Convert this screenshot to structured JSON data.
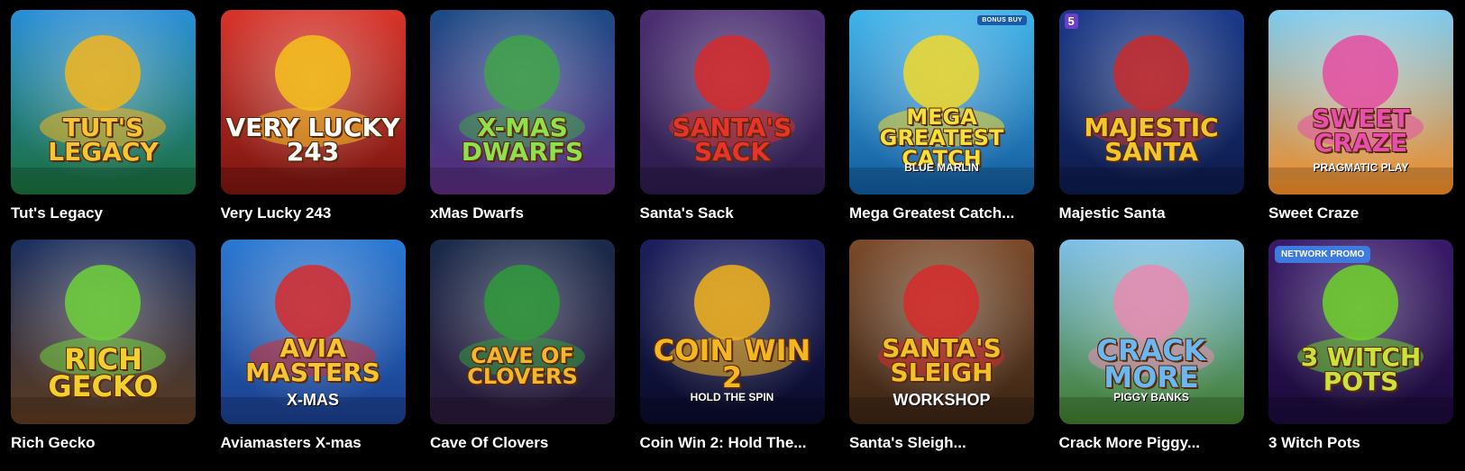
{
  "games": [
    {
      "name": "Tut's Legacy",
      "art_title": "Tut's Legacy",
      "art_sub": "",
      "badge": "",
      "bg_top": "#2a8fd8",
      "bg_bottom": "#1a6e3a",
      "accent": "#f3b51c",
      "title_color": "#f6c533",
      "icon": "pharaoh-icon"
    },
    {
      "name": "Very Lucky 243",
      "art_title": "Very Lucky 243",
      "art_sub": "",
      "badge": "",
      "bg_top": "#d8342a",
      "bg_bottom": "#7a1510",
      "accent": "#f5c21b",
      "title_color": "#ffffff",
      "icon": "turtle-icon"
    },
    {
      "name": "xMas Dwarfs",
      "art_title": "X-Mas Dwarfs",
      "art_sub": "",
      "badge": "",
      "bg_top": "#1d4b86",
      "bg_bottom": "#5a2b7c",
      "accent": "#3fa348",
      "title_color": "#8ee04c",
      "icon": "gift-icon"
    },
    {
      "name": "Santa's Sack",
      "art_title": "Santa's Sack",
      "art_sub": "",
      "badge": "",
      "bg_top": "#4b2e73",
      "bg_bottom": "#2a1a4a",
      "accent": "#d62a2a",
      "title_color": "#e8322b",
      "icon": "sleigh-icon"
    },
    {
      "name": "Mega Greatest Catch...",
      "art_title": "Mega Greatest Catch",
      "art_sub": "Blue Marlin",
      "badge": "BONUS BUY",
      "bg_top": "#42b4ea",
      "bg_bottom": "#125a9c",
      "accent": "#f1d82a",
      "title_color": "#f4e03a",
      "icon": "fish-icon"
    },
    {
      "name": "Majestic Santa",
      "art_title": "Majestic Santa",
      "art_sub": "",
      "badge": "5",
      "bg_top": "#1b3a8a",
      "bg_bottom": "#0d1a4a",
      "accent": "#c92a2a",
      "title_color": "#f3c72c",
      "icon": "santa-icon"
    },
    {
      "name": "Sweet Craze",
      "art_title": "Sweet Craze",
      "art_sub": "Pragmatic Play",
      "badge": "",
      "bg_top": "#7ecbf0",
      "bg_bottom": "#f08a24",
      "accent": "#e54ca0",
      "title_color": "#e84db0",
      "icon": "candy-icon"
    },
    {
      "name": "Rich Gecko",
      "art_title": "Rich Gecko",
      "art_sub": "",
      "badge": "",
      "bg_top": "#1b2f5e",
      "bg_bottom": "#5b3a1f",
      "accent": "#6fd13a",
      "title_color": "#f3d12c",
      "icon": "gecko-icon"
    },
    {
      "name": "Aviamasters X-mas",
      "art_title": "Avia Masters",
      "art_sub": "X-Mas",
      "badge": "",
      "bg_top": "#2a78d2",
      "bg_bottom": "#1a3d8c",
      "accent": "#d72a2a",
      "title_color": "#f6c531",
      "icon": "plane-icon"
    },
    {
      "name": "Cave Of Clovers",
      "art_title": "Cave of Clovers",
      "art_sub": "",
      "badge": "",
      "bg_top": "#1a2a4a",
      "bg_bottom": "#2a1838",
      "accent": "#2f9a3a",
      "title_color": "#f3b62c",
      "icon": "leprechaun-icon"
    },
    {
      "name": "Coin Win 2: Hold The...",
      "art_title": "Coin Win 2",
      "art_sub": "Hold the Spin",
      "badge": "",
      "bg_top": "#1d1f5e",
      "bg_bottom": "#0a0b2a",
      "accent": "#f2b21b",
      "title_color": "#f4b722",
      "icon": "coin-icon"
    },
    {
      "name": "Santa's Sleigh...",
      "art_title": "Santa's Sleigh",
      "art_sub": "Workshop",
      "badge": "",
      "bg_top": "#7a4a2a",
      "bg_bottom": "#3a2414",
      "accent": "#d62a2a",
      "title_color": "#f2c12a",
      "icon": "santa-icon"
    },
    {
      "name": "Crack More Piggy...",
      "art_title": "Crack More",
      "art_sub": "Piggy Banks",
      "badge": "",
      "bg_top": "#7fc0e8",
      "bg_bottom": "#3f7a2a",
      "accent": "#e88ab0",
      "title_color": "#6ab8f2",
      "icon": "pig-icon"
    },
    {
      "name": "3 Witch Pots",
      "art_title": "3 Witch Pots",
      "art_sub": "",
      "badge": "NETWORK PROMO",
      "bg_top": "#3a1a6a",
      "bg_bottom": "#1a0a38",
      "accent": "#6ed22a",
      "title_color": "#c9e23c",
      "icon": "witch-icon"
    }
  ]
}
